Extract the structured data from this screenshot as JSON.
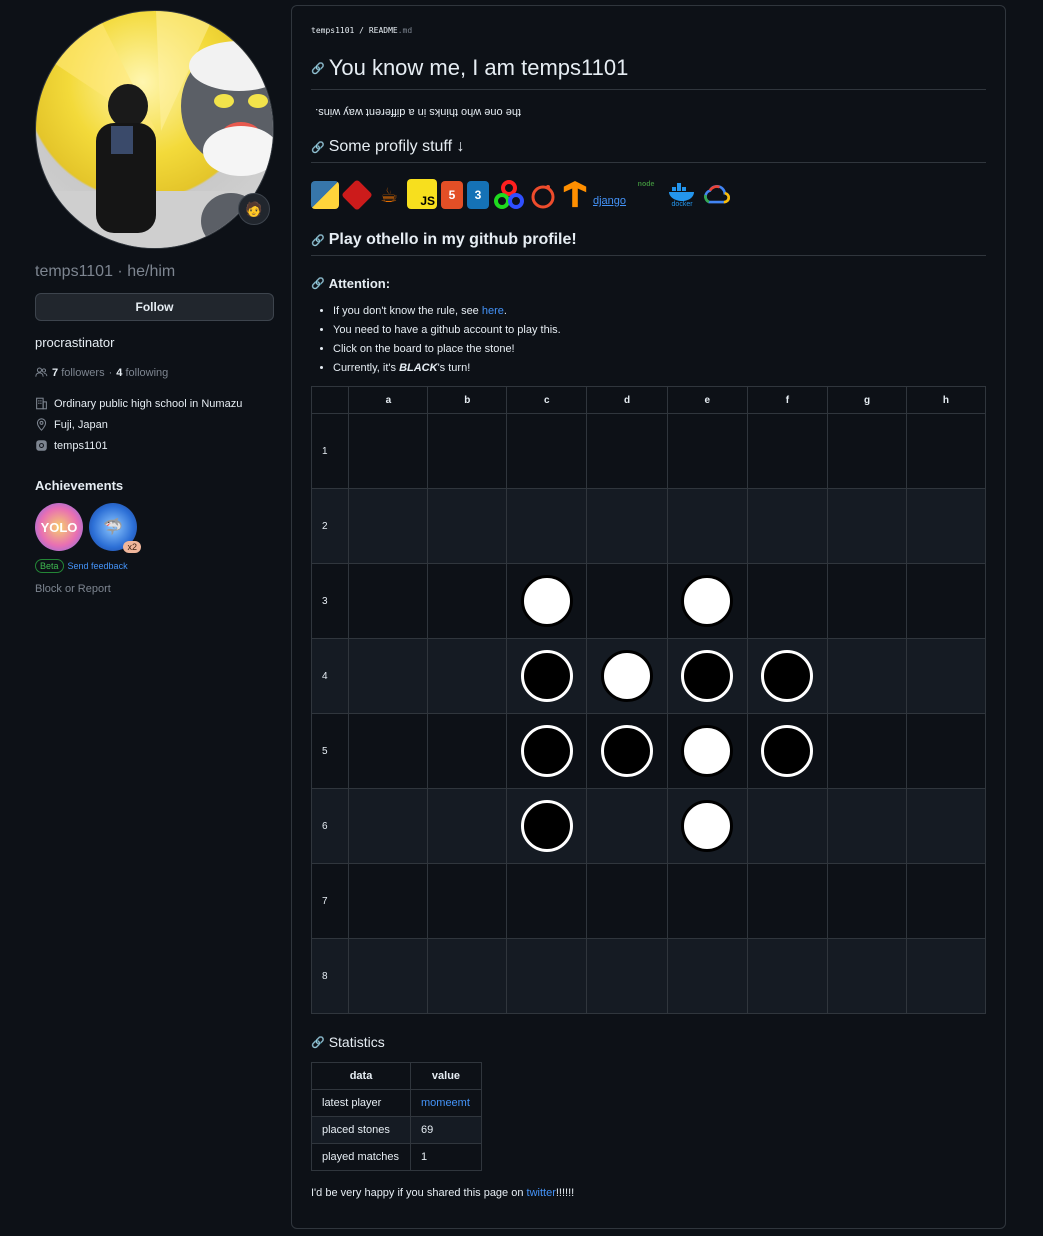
{
  "profile": {
    "username": "temps1101 · he/him",
    "follow_label": "Follow",
    "bio": "procrastinator",
    "followers_count": "7",
    "followers_label": "followers",
    "following_count": "4",
    "following_label": "following",
    "company": "Ordinary public high school in Numazu",
    "location": "Fuji, Japan",
    "social": "temps1101",
    "achievements_title": "Achievements",
    "achievement_multiplier": "x2",
    "beta_label": "Beta",
    "feedback_label": "Send feedback",
    "block_label": "Block or Report"
  },
  "readme": {
    "path_user": "temps1101",
    "path_sep": " / ",
    "path_file": "README",
    "path_ext": ".md",
    "title": "You know me, I am temps1101",
    "flipped_text": "the one who thinks in a different way wins.",
    "h2_profily": "Some profily stuff ↓",
    "django_alt": "django",
    "h2_othello": "Play othello in my github profile!",
    "h3_attention": "Attention:",
    "rule1_prefix": "If you don't know the rule, see ",
    "rule1_link": "here",
    "rule1_suffix": ".",
    "rule2": "You need to have a github account to play this.",
    "rule3": "Click on the board to place the stone!",
    "rule4_prefix": "Currently, it's ",
    "rule4_bold": "BLACK",
    "rule4_suffix": "'s turn!",
    "h3_statistics": "Statistics",
    "happy_prefix": "I'd be very happy if you shared this page on ",
    "happy_link": "twitter",
    "happy_suffix": "!!!!!!"
  },
  "board": {
    "columns": [
      "a",
      "b",
      "c",
      "d",
      "e",
      "f",
      "g",
      "h"
    ],
    "rows": [
      "1",
      "2",
      "3",
      "4",
      "5",
      "6",
      "7",
      "8"
    ],
    "cells": [
      [
        "",
        "",
        "",
        "",
        "",
        "",
        "",
        ""
      ],
      [
        "",
        "",
        "",
        "",
        "",
        "",
        "",
        ""
      ],
      [
        "",
        "",
        "W",
        "",
        "W",
        "",
        "",
        ""
      ],
      [
        "",
        "",
        "B",
        "W",
        "B",
        "B",
        "",
        ""
      ],
      [
        "",
        "",
        "B",
        "B",
        "W",
        "B",
        "",
        ""
      ],
      [
        "",
        "",
        "B",
        "",
        "W",
        "",
        "",
        ""
      ],
      [
        "",
        "",
        "",
        "",
        "",
        "",
        "",
        ""
      ],
      [
        "",
        "",
        "",
        "",
        "",
        "",
        "",
        ""
      ]
    ]
  },
  "stats": {
    "header_data": "data",
    "header_value": "value",
    "latest_player_label": "latest player",
    "latest_player_value": "momeemt",
    "placed_stones_label": "placed stones",
    "placed_stones_value": "69",
    "played_matches_label": "played matches",
    "played_matches_value": "1"
  },
  "colors": {
    "background": "#0d1117",
    "border": "#30363d",
    "link": "#4493f8",
    "muted": "#7d8590"
  }
}
